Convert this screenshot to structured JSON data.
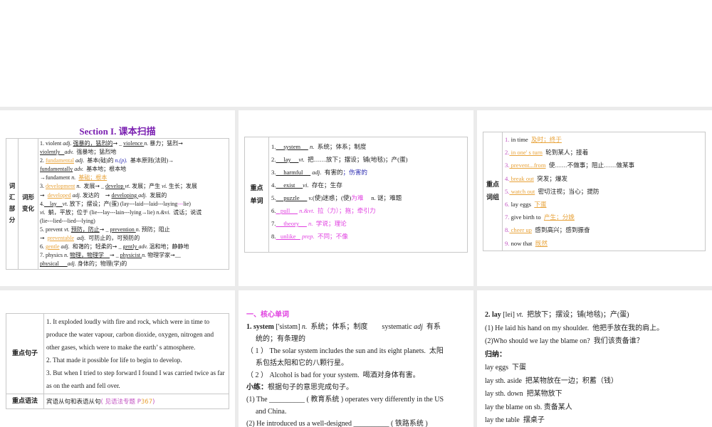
{
  "slide1": {
    "title": "Section I.  课本扫描",
    "label_part": "词汇部分",
    "label_sub": "词形变化",
    "lines": [
      [
        {
          "t": "1. violent "
        },
        {
          "t": "adj.",
          "c": "i"
        },
        {
          "t": " "
        },
        {
          "t": "强暴的，猛烈的",
          "c": "u"
        },
        {
          "t": "➞ _ "
        },
        {
          "t": "violence ",
          "c": "u"
        },
        {
          "t": "n.",
          "c": "i"
        },
        {
          "t": " 暴力；猛烈➞"
        }
      ],
      [
        {
          "t": "violently   ",
          "c": "u"
        },
        {
          "t": "adv.",
          "c": "i"
        },
        {
          "t": "  强暴地；猛烈地"
        }
      ],
      [
        {
          "t": "2. "
        },
        {
          "t": "fundamental",
          "c": "u o"
        },
        {
          "t": " adj.",
          "c": "i"
        },
        {
          "t": "  基本(础)的 "
        },
        {
          "t": "n.(p).",
          "c": "i b"
        },
        {
          "t": "  基本原则(法则)→"
        }
      ],
      [
        {
          "t": "fundamentally",
          "c": "u"
        },
        {
          "t": " adv.",
          "c": "i"
        },
        {
          "t": "  基本地；根本地"
        }
      ],
      [
        {
          "t": "→fundament "
        },
        {
          "t": "n.",
          "c": "i"
        },
        {
          "t": "  "
        },
        {
          "t": "基础；根本",
          "c": "u o"
        }
      ],
      [
        {
          "t": "3. "
        },
        {
          "t": "development",
          "c": "u o"
        },
        {
          "t": " n.",
          "c": "i"
        },
        {
          "t": "  发展➞ _ "
        },
        {
          "t": "develop ",
          "c": "u"
        },
        {
          "t": "vt.",
          "c": "i"
        },
        {
          "t": " 发展；产生 "
        },
        {
          "t": "vi.",
          "c": "i"
        },
        {
          "t": " 生长；发展"
        }
      ],
      [
        {
          "t": "➞  "
        },
        {
          "t": "developed",
          "c": "u o"
        },
        {
          "t": " adj.",
          "c": "i"
        },
        {
          "t": " 发达的    ➞ "
        },
        {
          "t": "developing ",
          "c": "u"
        },
        {
          "t": "adj.",
          "c": "i"
        },
        {
          "t": "  发展的"
        }
      ],
      [
        {
          "t": "4."
        },
        {
          "t": "    lay    ",
          "c": "u"
        },
        {
          "t": "vt.",
          "c": "i"
        },
        {
          "t": " 放下；摆设；产(蛋) (lay---laid---laid---laying"
        },
        {
          "t": "---",
          "c": "m"
        },
        {
          "t": "lie)"
        }
      ],
      [
        {
          "t": "vi.",
          "c": "i"
        },
        {
          "t": "  躺，平放；位于 (lie---lay---lain---lying→lie) "
        },
        {
          "t": "n.&vi.",
          "c": "i"
        },
        {
          "t": "  谎话；说谎"
        }
      ],
      [
        {
          "t": "(lie---lied---lied---lying)"
        }
      ],
      [
        {
          "t": "5. prevent "
        },
        {
          "t": "vt.",
          "c": "i"
        },
        {
          "t": " "
        },
        {
          "t": "预防，防止",
          "c": "u"
        },
        {
          "t": "➞ _ "
        },
        {
          "t": "prevention ",
          "c": "u"
        },
        {
          "t": "n.",
          "c": "i"
        },
        {
          "t": " 预防；阻止"
        }
      ],
      [
        {
          "t": "➞  "
        },
        {
          "t": "preventable",
          "c": "u o"
        },
        {
          "t": "  adj.",
          "c": "i"
        },
        {
          "t": "  可防止的，可预防的"
        }
      ],
      [
        {
          "t": "6. "
        },
        {
          "t": "gentle",
          "c": "u o"
        },
        {
          "t": " adj.",
          "c": "i"
        },
        {
          "t": "  和蔼的；轻柔的➞ _ "
        },
        {
          "t": "gently ",
          "c": "u"
        },
        {
          "t": "adv.",
          "c": "i"
        },
        {
          "t": " 温和地；静静地"
        }
      ],
      [
        {
          "t": "7. physics "
        },
        {
          "t": "n.",
          "c": "i"
        },
        {
          "t": " "
        },
        {
          "t": "物理，物理学    ",
          "c": "u"
        },
        {
          "t": "➞ _ "
        },
        {
          "t": "physicist ",
          "c": "u"
        },
        {
          "t": "n.",
          "c": "i"
        },
        {
          "t": " 物理学家➞__"
        }
      ],
      [
        {
          "t": "physical      ",
          "c": "u"
        },
        {
          "t": "adj.",
          "c": "i"
        },
        {
          "t": " 身体的；物理(学)的"
        }
      ]
    ]
  },
  "slide2": {
    "label": "重点单词",
    "lines": [
      [
        {
          "t": "1."
        },
        {
          "t": "     system     ",
          "c": "u"
        },
        {
          "t": " "
        },
        {
          "t": "n.",
          "c": "i"
        },
        {
          "t": "  系统；体系；制度"
        }
      ],
      [
        {
          "t": "2."
        },
        {
          "t": "     lay     ",
          "c": "u"
        },
        {
          "t": "vt.",
          "c": "i"
        },
        {
          "t": "  把……放下；摆设；铺(地毯)；产(蛋)"
        }
      ],
      [
        {
          "t": "3."
        },
        {
          "t": "     harmful     ",
          "c": "u"
        },
        {
          "t": " adj.",
          "c": "i"
        },
        {
          "t": "  有害的"
        },
        {
          "t": "；伤害的",
          "c": "b"
        }
      ],
      [
        {
          "t": "4."
        },
        {
          "t": "     exist     ",
          "c": "u"
        },
        {
          "t": "vi.",
          "c": "i"
        },
        {
          "t": "  存在；生存"
        }
      ],
      [
        {
          "t": "5."
        },
        {
          "t": "     puzzle     ",
          "c": "u"
        },
        {
          "t": " v.",
          "c": "i"
        },
        {
          "t": "(使)迷惑；(使)"
        },
        {
          "t": "为难",
          "c": "m"
        },
        {
          "t": "     n. 谜；难题"
        }
      ],
      [
        {
          "t": "6."
        },
        {
          "t": "   pull     ",
          "c": "u m"
        },
        {
          "t": " n.&vt.",
          "c": "i m"
        },
        {
          "t": "  拉（力）；拖；牵引力",
          "c": "m"
        }
      ],
      [
        {
          "t": "7."
        },
        {
          "t": "     theory     ",
          "c": "u m"
        },
        {
          "t": " n.",
          "c": "i m"
        },
        {
          "t": "  学说；理论",
          "c": "m"
        }
      ],
      [
        {
          "t": "8."
        },
        {
          "t": "   unlike   ",
          "c": "u m"
        },
        {
          "t": " prep.",
          "c": "i m"
        },
        {
          "t": "  不同；不像",
          "c": "m"
        }
      ]
    ]
  },
  "slide3": {
    "label": "重点词组",
    "lines": [
      [
        {
          "t": "1.",
          "c": "p"
        },
        {
          "t": " in time  "
        },
        {
          "t": "及时；终于",
          "c": "u o"
        }
      ],
      [
        {
          "t": "2.",
          "c": "p"
        },
        {
          "t": " in one' s turn",
          "c": "u o"
        },
        {
          "t": "  轮到某人；接着"
        }
      ],
      [
        {
          "t": "3.",
          "c": "p"
        },
        {
          "t": " prevent...from",
          "c": "u o"
        },
        {
          "t": "  使……不做事；阻止……做某事"
        }
      ],
      [
        {
          "t": "4.",
          "c": "p"
        },
        {
          "t": " break out",
          "c": "u o"
        },
        {
          "t": "  突发；爆发"
        }
      ],
      [
        {
          "t": "5.",
          "c": "p"
        },
        {
          "t": " watch out",
          "c": "u o"
        },
        {
          "t": "  密切注视；当心；提防"
        }
      ],
      [
        {
          "t": "6.",
          "c": "p"
        },
        {
          "t": " lay eggs  "
        },
        {
          "t": "下蛋",
          "c": "u o"
        }
      ],
      [
        {
          "t": "7.",
          "c": "p"
        },
        {
          "t": " give birth to  "
        },
        {
          "t": "产生；分娩",
          "c": "u o"
        }
      ],
      [
        {
          "t": "8.",
          "c": "p"
        },
        {
          "t": " cheer up",
          "c": "u o"
        },
        {
          "t": "  感到高兴；感到振奋"
        }
      ],
      [
        {
          "t": "9.",
          "c": "p"
        },
        {
          "t": " now that  "
        },
        {
          "t": "既然",
          "c": "u o"
        }
      ]
    ]
  },
  "slide4": {
    "label_sentences": "重点句子",
    "sentences": [
      "1. It exploded loudly with fire and rock, which were in time to produce the water vapour, carbon dioxide, oxygen, nitrogen and other gases, which were to make the earth’ s atmosphere.",
      "2. That made it possible for life to begin to develop.",
      "3. But when I tried to step forward I found I was carried twice as far as on the earth and fell over."
    ],
    "label_grammar": "重点语法",
    "grammar": "宾语从句和表语从句",
    "grammar_ref": "( 见语法专题 P",
    "grammar_page": "367",
    "grammar_close": ")"
  },
  "slide5": {
    "heading": "一、核心单词",
    "lines": [
      {
        "cls": "",
        "segs": [
          {
            "t": "1. system",
            "c": "k"
          },
          {
            "t": " ['sistəm] "
          },
          {
            "t": "n.",
            "c": "i"
          },
          {
            "t": "  系统；体系；制度        systematic "
          },
          {
            "t": "adj",
            "c": "i"
          },
          {
            "t": "  有系"
          }
        ]
      },
      {
        "cls": "indent",
        "segs": [
          {
            "t": "统的；有条理的"
          }
        ]
      },
      {
        "cls": "",
        "segs": [
          {
            "t": "（ 1 ） The solar system includes the sun and its eight planets.  太阳"
          }
        ]
      },
      {
        "cls": "indent",
        "segs": [
          {
            "t": "系包括太阳和它的八颗行星。"
          }
        ]
      },
      {
        "cls": "",
        "segs": [
          {
            "t": "（ 2 ） Alcohol is bad for your system.  喝酒对身体有害。"
          }
        ]
      },
      {
        "cls": "",
        "segs": [
          {
            "t": "小练：",
            "c": "k"
          },
          {
            "t": "根据句子的意思完成句子。"
          }
        ]
      },
      {
        "cls": "",
        "segs": [
          {
            "t": "(1) The __________ ( 教育系统 ) operates very differently in the US"
          }
        ]
      },
      {
        "cls": "indent",
        "segs": [
          {
            "t": "and China."
          }
        ]
      },
      {
        "cls": "",
        "segs": [
          {
            "t": "(2) He introduced us a well-designed __________ ( 铁路系统 )"
          }
        ]
      }
    ]
  },
  "slide6": {
    "lines": [
      [
        {
          "t": "2. lay",
          "c": "k"
        },
        {
          "t": " [lei] "
        },
        {
          "t": "vt.",
          "c": "i"
        },
        {
          "t": "  把放下；摆设；铺(地毯)；产(蛋)"
        }
      ],
      [
        {
          "t": "(1) He laid his hand on my shoulder.  他把手放在我的肩上。"
        }
      ],
      [
        {
          "t": "(2)Who should we lay the blame on?  我们该责备谁？"
        }
      ],
      [
        {
          "t": "归纳：",
          "c": "k"
        }
      ],
      [
        {
          "t": "lay eggs  下蛋"
        }
      ],
      [
        {
          "t": "lay sth. aside  把某物放在一边；积蓄（钱）"
        }
      ],
      [
        {
          "t": "lay sth. down  把某物放下"
        }
      ],
      [
        {
          "t": "lay the blame on sb. 责备某人"
        }
      ],
      [
        {
          "t": "lay the table  摆桌子"
        }
      ]
    ]
  },
  "colors": {
    "orange": "#e8a33a",
    "magenta": "#e040e0",
    "purple": "#7a1fb0",
    "background": "#ebebeb"
  }
}
